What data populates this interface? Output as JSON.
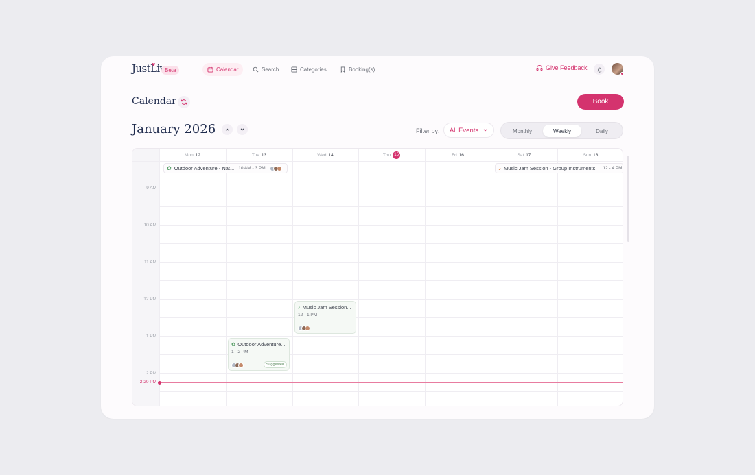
{
  "app": {
    "logo": "JustLiv",
    "beta": "Beta"
  },
  "nav": {
    "items": [
      {
        "label": "Calendar",
        "icon": "calendar-icon",
        "active": true
      },
      {
        "label": "Search",
        "icon": "search-icon"
      },
      {
        "label": "Categories",
        "icon": "grid-icon"
      },
      {
        "label": "Booking(s)",
        "icon": "bookmark-icon"
      }
    ]
  },
  "header": {
    "feedback": "Give Feedback",
    "bell": "bell-icon",
    "avatar": "user-avatar"
  },
  "page": {
    "title": "Calendar",
    "book_label": "Book",
    "month_label": "January 2026"
  },
  "filter": {
    "label": "Filter by:",
    "value": "All Events"
  },
  "views": {
    "monthly": "Monthly",
    "weekly": "Weekly",
    "daily": "Daily",
    "selected": "Weekly"
  },
  "days": [
    {
      "dow": "Mon",
      "num": "12"
    },
    {
      "dow": "Tue",
      "num": "13"
    },
    {
      "dow": "Wed",
      "num": "14"
    },
    {
      "dow": "Thu",
      "num": "15",
      "today": true
    },
    {
      "dow": "Fri",
      "num": "16"
    },
    {
      "dow": "Sat",
      "num": "17"
    },
    {
      "dow": "Sun",
      "num": "18"
    }
  ],
  "times": [
    "9 AM",
    "10 AM",
    "11 AM",
    "12 PM",
    "1 PM",
    "2 PM"
  ],
  "now": "2:20 PM",
  "all_day_events": [
    {
      "title": "Outdoor Adventure - Nat...",
      "time": "10 AM - 3 PM",
      "icon": "leaf-icon",
      "color": "#5aa06a"
    },
    {
      "title": "Music Jam Session - Group Instruments",
      "time": "12 - 4 PM",
      "icon": "guitar-icon",
      "color": "#e08a4a"
    }
  ],
  "events": [
    {
      "title": "Music Jam Session...",
      "time": "12 - 1 PM",
      "icon": "guitar-icon",
      "color": "#5aa06a"
    },
    {
      "title": "Outdoor Adventure...",
      "time": "1 - 2 PM",
      "icon": "leaf-icon",
      "color": "#5aa06a",
      "badge": "Suggested"
    }
  ],
  "colors": {
    "accent": "#d4336e",
    "event_green": "#5aa06a"
  }
}
